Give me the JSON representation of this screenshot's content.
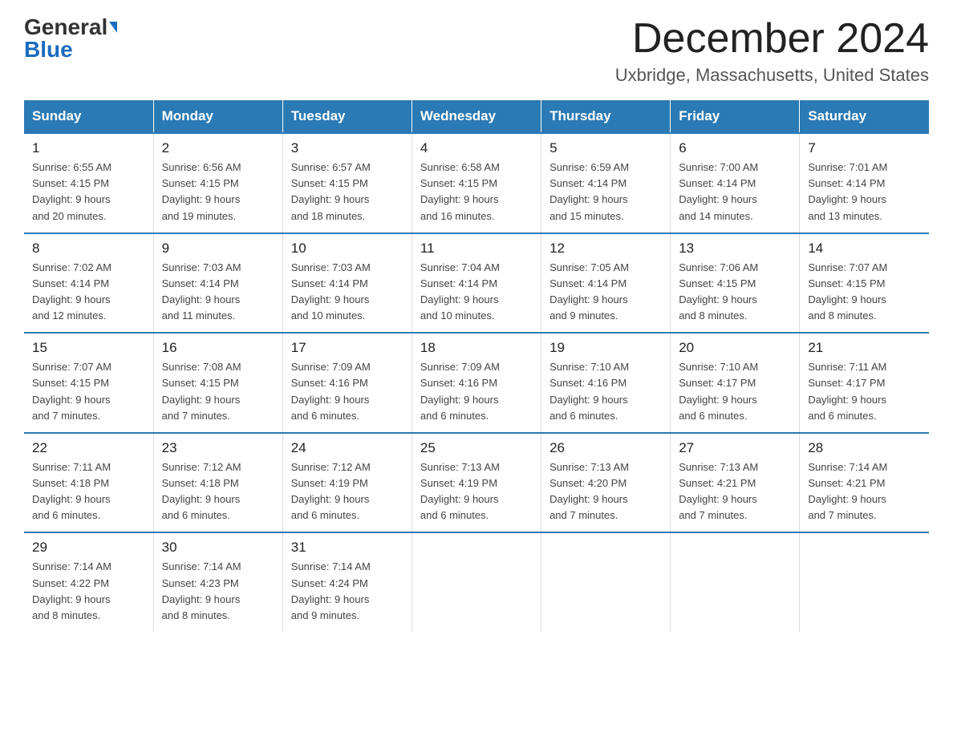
{
  "header": {
    "logo_general": "General",
    "logo_blue": "Blue",
    "month": "December 2024",
    "location": "Uxbridge, Massachusetts, United States"
  },
  "days_of_week": [
    "Sunday",
    "Monday",
    "Tuesday",
    "Wednesday",
    "Thursday",
    "Friday",
    "Saturday"
  ],
  "weeks": [
    [
      {
        "day": "1",
        "sunrise": "6:55 AM",
        "sunset": "4:15 PM",
        "daylight": "9 hours and 20 minutes."
      },
      {
        "day": "2",
        "sunrise": "6:56 AM",
        "sunset": "4:15 PM",
        "daylight": "9 hours and 19 minutes."
      },
      {
        "day": "3",
        "sunrise": "6:57 AM",
        "sunset": "4:15 PM",
        "daylight": "9 hours and 18 minutes."
      },
      {
        "day": "4",
        "sunrise": "6:58 AM",
        "sunset": "4:15 PM",
        "daylight": "9 hours and 16 minutes."
      },
      {
        "day": "5",
        "sunrise": "6:59 AM",
        "sunset": "4:14 PM",
        "daylight": "9 hours and 15 minutes."
      },
      {
        "day": "6",
        "sunrise": "7:00 AM",
        "sunset": "4:14 PM",
        "daylight": "9 hours and 14 minutes."
      },
      {
        "day": "7",
        "sunrise": "7:01 AM",
        "sunset": "4:14 PM",
        "daylight": "9 hours and 13 minutes."
      }
    ],
    [
      {
        "day": "8",
        "sunrise": "7:02 AM",
        "sunset": "4:14 PM",
        "daylight": "9 hours and 12 minutes."
      },
      {
        "day": "9",
        "sunrise": "7:03 AM",
        "sunset": "4:14 PM",
        "daylight": "9 hours and 11 minutes."
      },
      {
        "day": "10",
        "sunrise": "7:03 AM",
        "sunset": "4:14 PM",
        "daylight": "9 hours and 10 minutes."
      },
      {
        "day": "11",
        "sunrise": "7:04 AM",
        "sunset": "4:14 PM",
        "daylight": "9 hours and 10 minutes."
      },
      {
        "day": "12",
        "sunrise": "7:05 AM",
        "sunset": "4:14 PM",
        "daylight": "9 hours and 9 minutes."
      },
      {
        "day": "13",
        "sunrise": "7:06 AM",
        "sunset": "4:15 PM",
        "daylight": "9 hours and 8 minutes."
      },
      {
        "day": "14",
        "sunrise": "7:07 AM",
        "sunset": "4:15 PM",
        "daylight": "9 hours and 8 minutes."
      }
    ],
    [
      {
        "day": "15",
        "sunrise": "7:07 AM",
        "sunset": "4:15 PM",
        "daylight": "9 hours and 7 minutes."
      },
      {
        "day": "16",
        "sunrise": "7:08 AM",
        "sunset": "4:15 PM",
        "daylight": "9 hours and 7 minutes."
      },
      {
        "day": "17",
        "sunrise": "7:09 AM",
        "sunset": "4:16 PM",
        "daylight": "9 hours and 6 minutes."
      },
      {
        "day": "18",
        "sunrise": "7:09 AM",
        "sunset": "4:16 PM",
        "daylight": "9 hours and 6 minutes."
      },
      {
        "day": "19",
        "sunrise": "7:10 AM",
        "sunset": "4:16 PM",
        "daylight": "9 hours and 6 minutes."
      },
      {
        "day": "20",
        "sunrise": "7:10 AM",
        "sunset": "4:17 PM",
        "daylight": "9 hours and 6 minutes."
      },
      {
        "day": "21",
        "sunrise": "7:11 AM",
        "sunset": "4:17 PM",
        "daylight": "9 hours and 6 minutes."
      }
    ],
    [
      {
        "day": "22",
        "sunrise": "7:11 AM",
        "sunset": "4:18 PM",
        "daylight": "9 hours and 6 minutes."
      },
      {
        "day": "23",
        "sunrise": "7:12 AM",
        "sunset": "4:18 PM",
        "daylight": "9 hours and 6 minutes."
      },
      {
        "day": "24",
        "sunrise": "7:12 AM",
        "sunset": "4:19 PM",
        "daylight": "9 hours and 6 minutes."
      },
      {
        "day": "25",
        "sunrise": "7:13 AM",
        "sunset": "4:19 PM",
        "daylight": "9 hours and 6 minutes."
      },
      {
        "day": "26",
        "sunrise": "7:13 AM",
        "sunset": "4:20 PM",
        "daylight": "9 hours and 7 minutes."
      },
      {
        "day": "27",
        "sunrise": "7:13 AM",
        "sunset": "4:21 PM",
        "daylight": "9 hours and 7 minutes."
      },
      {
        "day": "28",
        "sunrise": "7:14 AM",
        "sunset": "4:21 PM",
        "daylight": "9 hours and 7 minutes."
      }
    ],
    [
      {
        "day": "29",
        "sunrise": "7:14 AM",
        "sunset": "4:22 PM",
        "daylight": "9 hours and 8 minutes."
      },
      {
        "day": "30",
        "sunrise": "7:14 AM",
        "sunset": "4:23 PM",
        "daylight": "9 hours and 8 minutes."
      },
      {
        "day": "31",
        "sunrise": "7:14 AM",
        "sunset": "4:24 PM",
        "daylight": "9 hours and 9 minutes."
      },
      null,
      null,
      null,
      null
    ]
  ],
  "labels": {
    "sunrise": "Sunrise: ",
    "sunset": "Sunset: ",
    "daylight": "Daylight: "
  }
}
